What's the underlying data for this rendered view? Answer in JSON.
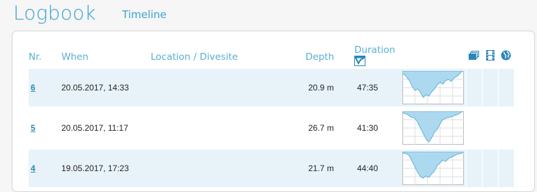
{
  "header": {
    "title": "Logbook",
    "subnav": "Timeline"
  },
  "table": {
    "columns": {
      "nr": "Nr.",
      "when": "When",
      "location": "Location / Divesite",
      "depth": "Depth",
      "duration": "Duration"
    },
    "header_icons": [
      "profile-chart-icon",
      "photos-icon",
      "video-icon",
      "globe-icon"
    ],
    "rows": [
      {
        "nr": "6",
        "when": "20.05.2017, 14:33",
        "location": "",
        "depth": "20.9 m",
        "duration": "47:35"
      },
      {
        "nr": "5",
        "when": "20.05.2017, 11:17",
        "location": "",
        "depth": "26.7 m",
        "duration": "41:30"
      },
      {
        "nr": "4",
        "when": "19.05.2017, 17:23",
        "location": "",
        "depth": "21.7 m",
        "duration": "44:40"
      }
    ]
  },
  "colors": {
    "accent": "#3ba3cf",
    "link": "#2a86b8",
    "row_shade": "#e8f3f9",
    "profile_fill": "#a8d8ef"
  }
}
